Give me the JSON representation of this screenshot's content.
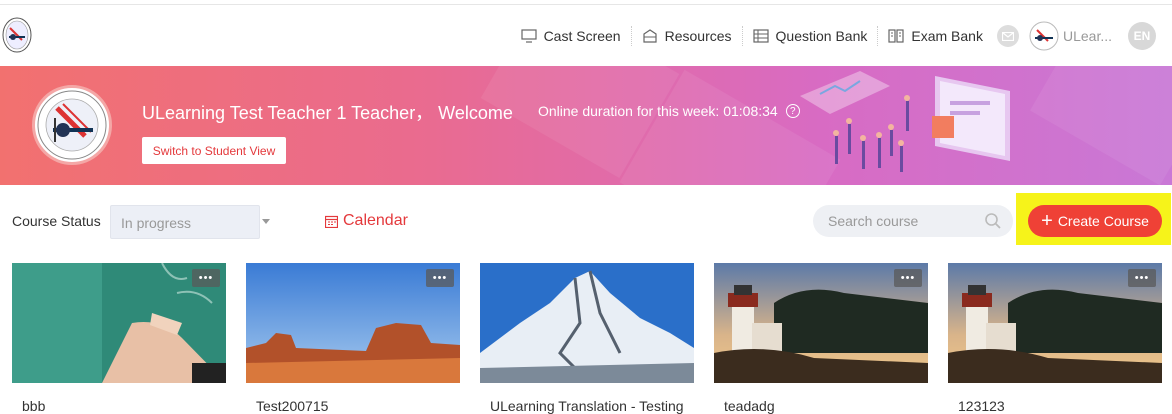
{
  "header": {
    "nav": [
      {
        "label": "Cast Screen",
        "icon": "monitor-icon"
      },
      {
        "label": "Resources",
        "icon": "resources-icon"
      },
      {
        "label": "Question Bank",
        "icon": "question-bank-icon"
      },
      {
        "label": "Exam Bank",
        "icon": "exam-bank-icon"
      }
    ],
    "user_name": "ULear...",
    "language": "EN"
  },
  "banner": {
    "welcome": "ULearning Test Teacher 1 Teacher， Welcome",
    "online_duration_label": "Online duration for this week:",
    "online_duration_value": "01:08:34",
    "help": "?",
    "switch_button": "Switch to Student View"
  },
  "toolbar": {
    "status_label": "Course Status",
    "status_value": "In progress",
    "calendar_label": "Calendar",
    "search_placeholder": "Search course",
    "create_button": "Create Course"
  },
  "courses": [
    {
      "title": "bbb",
      "thumb": "chalkboard",
      "more": "•••"
    },
    {
      "title": "Test200715",
      "thumb": "desert",
      "more": "•••"
    },
    {
      "title": "ULearning Translation - Testing",
      "thumb": "mountain",
      "more": ""
    },
    {
      "title": "teadadg",
      "thumb": "lighthouse",
      "more": "•••"
    },
    {
      "title": "123123",
      "thumb": "lighthouse",
      "more": "•••"
    }
  ],
  "colors": {
    "accent": "#ef4136",
    "highlight": "#f6f31a",
    "banner_start": "#f2716f",
    "banner_end": "#c978d6"
  }
}
